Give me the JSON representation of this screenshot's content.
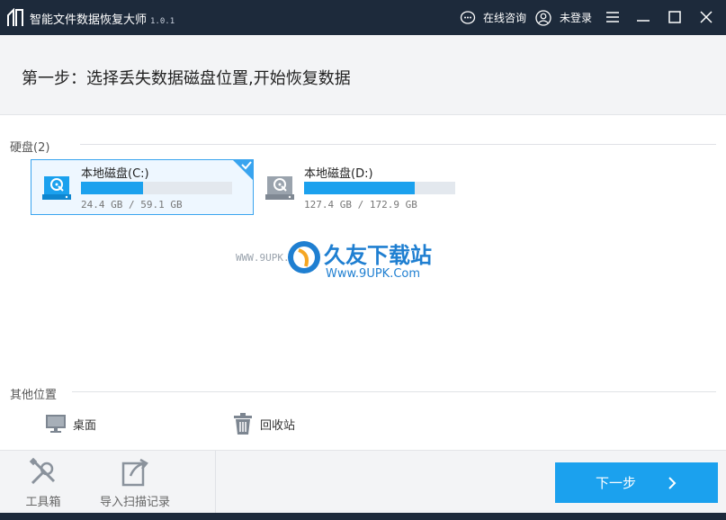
{
  "window": {
    "title": "智能文件数据恢复大师",
    "version": "1.0.1",
    "online_consult": "在线咨询",
    "login": "未登录"
  },
  "step": {
    "title": "第一步：选择丢失数据磁盘位置,开始恢复数据"
  },
  "disks": {
    "section_label": "硬盘(2)",
    "items": [
      {
        "name": "本地磁盘(C:)",
        "size": "24.4 GB / 59.1 GB",
        "used_fraction": 0.41,
        "selected": true
      },
      {
        "name": "本地磁盘(D:)",
        "size": "127.4 GB / 172.9 GB",
        "used_fraction": 0.73,
        "selected": false
      }
    ]
  },
  "watermark": {
    "url_small": "WWW.9UPK.COM",
    "brand": "久友下载站",
    "url": "Www.9UPK.Com"
  },
  "other": {
    "section_label": "其他位置",
    "items": [
      {
        "label": "桌面",
        "icon": "monitor-icon"
      },
      {
        "label": "回收站",
        "icon": "trash-icon"
      }
    ]
  },
  "bottom": {
    "toolbox_label": "工具箱",
    "import_label": "导入扫描记录",
    "next_label": "下一步"
  },
  "colors": {
    "titlebar": "#1d2a3b",
    "accent": "#1ba1ee",
    "selected_border": "#39a4ef"
  }
}
